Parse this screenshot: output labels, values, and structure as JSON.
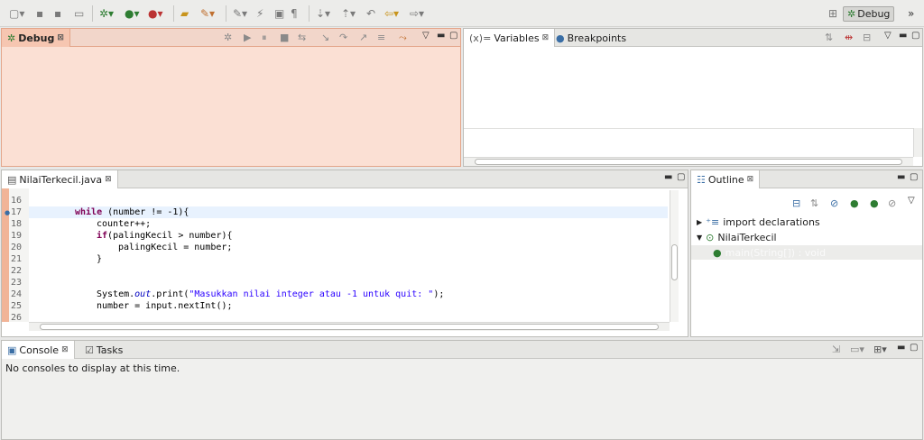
{
  "toolbar": {
    "perspective_label": "Debug",
    "overflow": "»"
  },
  "debug_view": {
    "tab_label": "Debug"
  },
  "variables_view": {
    "tabs": [
      {
        "label": "Variables"
      },
      {
        "label": "Breakpoints"
      }
    ]
  },
  "editor": {
    "tab_label": "NilaiTerkecil.java",
    "lines": [
      {
        "n": "16",
        "text": ""
      },
      {
        "n": "17",
        "text": ""
      },
      {
        "n": "18",
        "text": ""
      },
      {
        "n": "19",
        "text": ""
      },
      {
        "n": "20",
        "text": ""
      },
      {
        "n": "21",
        "text": ""
      },
      {
        "n": "22",
        "text": ""
      },
      {
        "n": "23",
        "text": ""
      },
      {
        "n": "24",
        "text": ""
      },
      {
        "n": "25",
        "text": ""
      },
      {
        "n": "26",
        "text": ""
      }
    ],
    "code": {
      "l17_kw": "while",
      "l17_rest": " (number != -1){",
      "l18": "counter++;",
      "l19_kw": "if",
      "l19_rest": "(palingKecil > number){",
      "l20": "palingKecil = number;",
      "l21": "}",
      "l24_a": "System.",
      "l24_fld": "out",
      "l24_b": ".print(",
      "l24_str": "\"Masukkan nilai integer atau -1 untuk quit: \"",
      "l24_c": ");",
      "l25": "number = input.nextInt();"
    }
  },
  "outline": {
    "tab_label": "Outline",
    "items": [
      {
        "label": "import declarations"
      },
      {
        "label": "NilaiTerkecil"
      },
      {
        "label": "main(String[]) : void"
      }
    ]
  },
  "console": {
    "tabs": [
      {
        "label": "Console"
      },
      {
        "label": "Tasks"
      }
    ],
    "message": "No consoles to display at this time."
  },
  "colors": {
    "debug_tab_bg": "#f6c6b1",
    "debug_body_bg": "#fbe0d4"
  }
}
